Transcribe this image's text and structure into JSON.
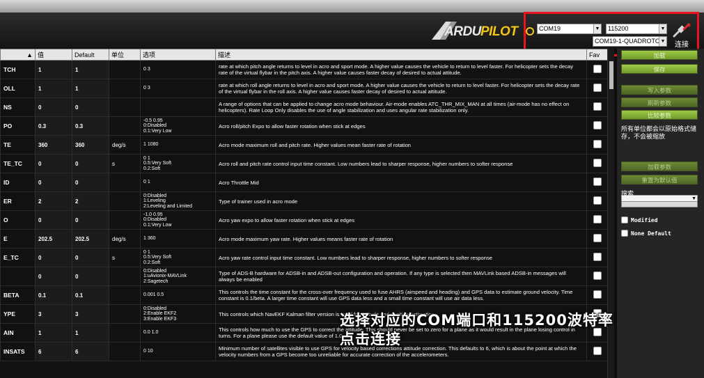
{
  "header": {
    "logo_text": "ARDUPILOT",
    "port": "COM19",
    "baud": "115200",
    "board": "COM19-1-QUADROTOR",
    "connect_label": "连接"
  },
  "table": {
    "columns": [
      "",
      "值",
      "Default",
      "单位",
      "选项",
      "描述",
      "Fav"
    ],
    "rows": [
      {
        "cmd": "TCH",
        "value": "1",
        "default": "1",
        "units": "",
        "options": "0 3",
        "desc": "rate at which pitch angle returns to level in acro and sport mode.  A higher value causes the vehicle to return to level faster. For helicopter sets the decay rate of the virtual flybar in the pitch axis. A higher value causes faster decay of desired to actual attitude."
      },
      {
        "cmd": "OLL",
        "value": "1",
        "default": "1",
        "units": "",
        "options": "0 3",
        "desc": "rate at which roll angle returns to level in acro and sport mode.  A higher value causes the vehicle to return to level faster. For helicopter sets the decay rate of the virtual flybar in the roll axis. A higher value causes faster decay of desired to actual attitude."
      },
      {
        "cmd": "NS",
        "value": "0",
        "default": "0",
        "units": "",
        "options": "",
        "desc": "A range of options that can be applied to change acro mode behaviour. Air-mode enables ATC_THR_MIX_MAN at all times (air-mode has no effect on helicopters). Rate Loop Only disables the use of angle stabilization and uses angular rate stabilization only."
      },
      {
        "cmd": "PO",
        "value": "0.3",
        "default": "0.3",
        "units": "",
        "options": "-0.5 0.95\n0:Disabled\n0.1:Very Low",
        "desc": "Acro roll/pitch Expo to allow faster rotation when stick at edges"
      },
      {
        "cmd": "TE",
        "value": "360",
        "default": "360",
        "units": "deg/s",
        "options": "1 1080",
        "desc": "Acro mode maximum roll and pitch rate.  Higher values mean faster rate of rotation"
      },
      {
        "cmd": "TE_TC",
        "value": "0",
        "default": "0",
        "units": "s",
        "options": "0 1\n0.5:Very Soft\n0.2:Soft",
        "desc": "Acro roll and pitch rate control input time constant.  Low numbers lead to sharper response, higher numbers to softer response"
      },
      {
        "cmd": "ID",
        "value": "0",
        "default": "0",
        "units": "",
        "options": "0 1",
        "desc": "Acro Throttle Mid"
      },
      {
        "cmd": "ER",
        "value": "2",
        "default": "2",
        "units": "",
        "options": "0:Disabled\n1:Leveling\n2:Leveling and Limited",
        "desc": "Type of trainer used in acro mode"
      },
      {
        "cmd": "O",
        "value": "0",
        "default": "0",
        "units": "",
        "options": "-1.0 0.95\n0:Disabled\n0.1:Very Low",
        "desc": "Acro yaw expo to allow faster rotation when stick at edges"
      },
      {
        "cmd": "E",
        "value": "202.5",
        "default": "202.5",
        "units": "deg/s",
        "options": "1 360",
        "desc": "Acro mode maximum yaw rate.  Higher values means faster rate of rotation"
      },
      {
        "cmd": "E_TC",
        "value": "0",
        "default": "0",
        "units": "s",
        "options": "0 1\n0.5:Very Soft\n0.2:Soft",
        "desc": "Acro yaw rate control input time constant.  Low numbers lead to sharper response, higher numbers to softer response"
      },
      {
        "cmd": "",
        "value": "0",
        "default": "0",
        "units": "",
        "options": "0:Disabled\n1:uAvionix-MAVLink\n2:Sagetech",
        "desc": "Type of ADS-B hardware for ADSB-in and ADSB-out configuration and operation. If any type is selected then MAVLink based ADSB-in messages will always be enabled"
      },
      {
        "cmd": "BETA",
        "value": "0.1",
        "default": "0.1",
        "units": "",
        "options": "0.001 0.5",
        "desc": "This controls the time constant for the cross-over frequency used to fuse AHRS (airspeed and heading) and GPS data to estimate ground velocity. Time constant is 0.1/beta. A larger time constant will use GPS data less and a small time constant will use air data less."
      },
      {
        "cmd": "YPE",
        "value": "3",
        "default": "3",
        "units": "",
        "options": "0:Disabled\n2:Enable EKF2\n3:Enable EKF3",
        "desc": "This controls which NavEKF Kalman filter version is used for attitude and position estimation"
      },
      {
        "cmd": "AIN",
        "value": "1",
        "default": "1",
        "units": "",
        "options": "0.0 1.0",
        "desc": "This controls how much to use the GPS to correct the attitude. This should never be set to zero for a plane as it would result in the plane losing control in turns. For a plane please use the default value of 1.0."
      },
      {
        "cmd": "INSATS",
        "value": "6",
        "default": "6",
        "units": "",
        "options": "0 10",
        "desc": "Minimum number of satellites visible to use GPS for velocity based corrections attitude correction. This defaults to 6, which is about the point at which the velocity numbers from a GPS become too unreliable for accurate correction of the accelerometers."
      }
    ]
  },
  "sidebar": {
    "load_button": "加载",
    "save_button": "保存",
    "write_button": "写入参数",
    "refresh_button": "刷新参数",
    "compare_button": "比较参数",
    "note": "所有单位都会以原始格式储存，不会被缩放",
    "load_preset_button": "加载参数",
    "reset_default_button": "重置为默认值",
    "search_label": "搜索",
    "modified_label": "Modified",
    "none_default_label": "None Default"
  },
  "caption": {
    "line1": "选择对应的COM端口和115200波特率",
    "line2": "点击连接"
  }
}
